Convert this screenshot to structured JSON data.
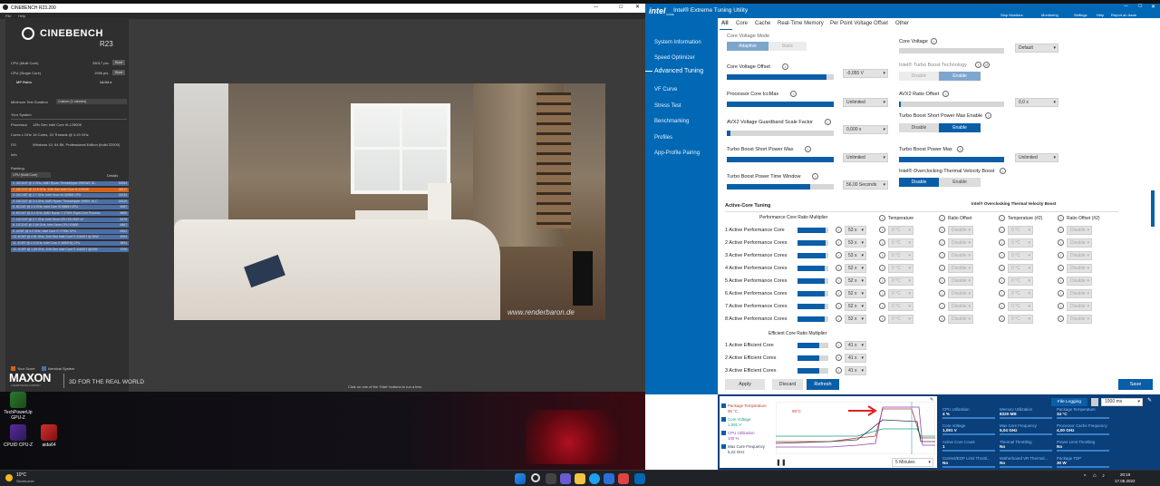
{
  "cinebench": {
    "window_title": "CINEBENCH R23.200",
    "menu": [
      "File",
      "Help"
    ],
    "logo": "CINEBENCH",
    "logo_sub": "R23",
    "tests": [
      {
        "label": "CPU (Multi Core)",
        "score": "28017 pts",
        "button": "Start"
      },
      {
        "label": "CPU (Single Core)",
        "score": "1996 pts",
        "button": "Start"
      }
    ],
    "mp_ratio_label": "MP Ratio",
    "mp_ratio_value": "14.04 x",
    "min_duration_label": "Minimum Test Duration",
    "min_duration_value": "Custom (1 minutes)",
    "your_system_label": "Your System",
    "system": [
      {
        "k": "Processor",
        "v": "12th Gen Intel Core i9-12900K"
      },
      {
        "k": "Cores x GHz",
        "v": "16 Cores, 24 Threads @ 3.19 GHz"
      },
      {
        "k": "OS",
        "v": "Windows 10, 64 Bit, Professional Edition (build 22000)"
      },
      {
        "k": "Info",
        "v": ""
      }
    ],
    "ranking_label": "Ranking",
    "ranking_select": "CPU (Multi Core)",
    "details_label": "Details",
    "ranking": [
      {
        "name": "1. 32C/64T @ 3 GHz, AMD Ryzen Threadripper 2990WX 32-",
        "score": "30054"
      },
      {
        "name": "2. 16C/24T @ 3.19 GHz, 12th Gen Intel Core i9-12900K",
        "score": "28017"
      },
      {
        "name": "3. 24C/48T @ 2.7 GHz, Intel Xeon W-3265M CPU",
        "score": "24243"
      },
      {
        "name": "4. 16C/32T @ 3.4 GHz, AMD Ryzen Threadripper 1950X 16-C",
        "score": "16315"
      },
      {
        "name": "5. 8C/16T @ 2.3 GHz, Intel Core i9-9880H CPU",
        "score": "9087"
      },
      {
        "name": "6. 8C/16T @ 3.4 GHz, AMD Ryzen 7 1700X Eight-Core Process",
        "score": "8889"
      },
      {
        "name": "7. 12C/24T @ 2.7 GHz, Intel Xeon CPU E5-2697 v2",
        "score": "8378"
      },
      {
        "name": "8. 12C/24T @ 2.66 GHz, Intel Xeon CPU X5650",
        "score": "6867"
      },
      {
        "name": "9. 4C/8T @ 4.2 GHz, Intel Core i7-7700K CPU",
        "score": "6302"
      },
      {
        "name": "10. 4C/8T @ 2.81 GHz, 11th Gen Intel Core i7-1165G7 @ 28W",
        "score": "4904"
      },
      {
        "name": "11. 4C/8T @ 2.3 GHz, Intel Core i7-4850HQ CPU",
        "score": "3891"
      },
      {
        "name": "12. 4C/8T @ 1.69 GHz, 11th Gen Intel Core i7-1165G7 @15W",
        "score": "3769"
      }
    ],
    "legend": [
      "Your Score",
      "Identical System"
    ],
    "brand": "MAXON",
    "brand_sub": "A NEMETSCHEK COMPANY",
    "tagline": "3D FOR THE REAL WORLD",
    "status": "Click on one of the 'Start' buttons to run a test.",
    "watermark": "www.renderbaron.de"
  },
  "desktop": {
    "icons": [
      {
        "label": "TechPowerUp GPU-Z"
      },
      {
        "label": "CPUID CPU-Z"
      },
      {
        "label": "aida64"
      }
    ]
  },
  "taskbar": {
    "weather_temp": "10°C",
    "weather_desc": "Słonecznie",
    "time": "20:19",
    "date": "17.05.2022"
  },
  "xtu": {
    "title": "Intel® Extreme Tuning Utility",
    "brand": "intel",
    "brand_sub": "CORE",
    "header_actions": [
      "Stop Monitors",
      "Monitoring",
      "Settings",
      "Help",
      "Report an Issue"
    ],
    "nav": [
      "System Information",
      "Speed Optimizer",
      "Advanced Tuning",
      "VF Curve",
      "Stress Test",
      "Benchmarking",
      "Profiles",
      "App-Profile Pairing"
    ],
    "tabs": [
      "All",
      "Core",
      "Cache",
      "Real-Time Memory",
      "Per Point Voltage Offset",
      "Other"
    ],
    "core_voltage_mode": {
      "label": "Core Voltage Mode",
      "opt1": "Adaptive",
      "opt2": "Static"
    },
    "core_voltage": {
      "label": "Core Voltage",
      "value": "Default"
    },
    "turbo_boost_tech": {
      "label": "Intel® Turbo Boost Technology",
      "opt1": "Disable",
      "opt2": "Enable"
    },
    "core_voltage_offset": {
      "label": "Core Voltage Offset",
      "value": "-0,055 V"
    },
    "proc_core_iccmax": {
      "label": "Processor Core IccMax",
      "value": "Unlimited"
    },
    "avx2_ratio_offset": {
      "label": "AVX2 Ratio Offset",
      "value": "0,0 x"
    },
    "turbo_short_enable": {
      "label": "Turbo Boost Short Power Max Enable",
      "opt1": "Disable",
      "opt2": "Enable"
    },
    "avx2_guardband": {
      "label": "AVX2 Voltage Guardband Scale Factor",
      "value": "0,000 x"
    },
    "turbo_short_power": {
      "label": "Turbo Boost Short Power Max",
      "value": "Unlimited"
    },
    "turbo_power_max": {
      "label": "Turbo Boost Power Max",
      "value": "Unlimited"
    },
    "turbo_time_window": {
      "label": "Turbo Boost Power Time Window",
      "value": "56,00 Seconds"
    },
    "otvb": {
      "label": "Intel® Overclocking Thermal Velocity Boost",
      "opt1": "Disable",
      "opt2": "Enable"
    },
    "active_core_title": "Active-Core Tuning",
    "otvb_col_title": "Intel® Overclocking Thermal Velocity Boost",
    "perf_ratio_title": "Performance Core Ratio Multiplier",
    "cols": [
      "Temperature",
      "Ratio Offset",
      "Temperature (#2)",
      "Ratio Offset (#2)"
    ],
    "perf_cores": [
      {
        "label": "1 Active Performance Core",
        "value": "53 x",
        "fill": 0.9
      },
      {
        "label": "2 Active Performance Cores",
        "value": "53 x",
        "fill": 0.9
      },
      {
        "label": "3 Active Performance Cores",
        "value": "53 x",
        "fill": 0.9
      },
      {
        "label": "4 Active Performance Cores",
        "value": "52 x",
        "fill": 0.88
      },
      {
        "label": "5 Active Performance Cores",
        "value": "52 x",
        "fill": 0.88
      },
      {
        "label": "6 Active Performance Cores",
        "value": "52 x",
        "fill": 0.88
      },
      {
        "label": "7 Active Performance Cores",
        "value": "52 x",
        "fill": 0.88
      },
      {
        "label": "8 Active Performance Cores",
        "value": "52 x",
        "fill": 0.88
      }
    ],
    "temp_value": "0 °C",
    "ratio_value": "Disable",
    "eff_ratio_title": "Efficient Core Ratio Multiplier",
    "eff_cores": [
      {
        "label": "1 Active Efficient Core",
        "value": "41 x",
        "fill": 0.7
      },
      {
        "label": "2 Active Efficient Cores",
        "value": "41 x",
        "fill": 0.7
      },
      {
        "label": "3 Active Efficient Cores",
        "value": "41 x",
        "fill": 0.7
      }
    ],
    "buttons": {
      "apply": "Apply",
      "discard": "Discard",
      "refresh": "Refresh",
      "save": "Save"
    },
    "monitor": {
      "checks": [
        {
          "label": "Package Temperature",
          "value": "95 °C"
        },
        {
          "label": "Core Voltage",
          "value": "1,091 V"
        },
        {
          "label": "CPU Utilization",
          "value": "100 %"
        },
        {
          "label": "Max Core Frequency",
          "value": "5,22 GHz"
        }
      ],
      "graph_peak": "95°C",
      "duration": "5 Minutes",
      "file_logging": "File Logging",
      "interval": "1000 ms",
      "stats": [
        {
          "k": "CPU Utilization",
          "v": "4 %"
        },
        {
          "k": "Memory Utilization",
          "v": "8320 MB"
        },
        {
          "k": "Package Temperature",
          "v": "34 °C"
        },
        {
          "k": "Core Voltage",
          "v": "1,091 V"
        },
        {
          "k": "Max Core Frequency",
          "v": "5,04 GHz"
        },
        {
          "k": "Processor Cache Frequency",
          "v": "4,00 GHz"
        },
        {
          "k": "Active Core Count",
          "v": "1"
        },
        {
          "k": "Thermal Throttling",
          "v": "No"
        },
        {
          "k": "Power Limit Throttling",
          "v": "No"
        },
        {
          "k": "Current/EDP Limit Throttl...",
          "v": "No"
        },
        {
          "k": "Motherboard VR Thermal...",
          "v": "No"
        },
        {
          "k": "Package TDP",
          "v": "30 W"
        }
      ]
    }
  },
  "colors": {
    "intel_blue": "#0068b5",
    "accent": "#0a5ea8",
    "cb_orange": "#d4621a",
    "cb_blue": "#4d6fa8"
  }
}
